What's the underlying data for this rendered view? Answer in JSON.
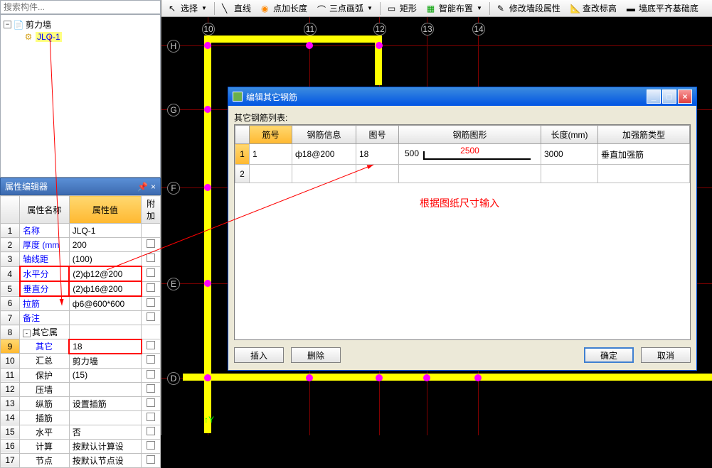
{
  "search_placeholder": "搜索构件...",
  "tree": {
    "root": "剪力墙",
    "child": "JLQ-1"
  },
  "prop_editor_title": "属性编辑器",
  "prop_headers": {
    "name": "属性名称",
    "value": "属性值",
    "extra": "附加"
  },
  "props": [
    {
      "n": "1",
      "name": "名称",
      "val": "JLQ-1",
      "blue": true
    },
    {
      "n": "2",
      "name": "厚度 (mm",
      "val": "200",
      "blue": true,
      "check": true
    },
    {
      "n": "3",
      "name": "轴线距",
      "val": "(100)",
      "blue": true,
      "check": true
    },
    {
      "n": "4",
      "name": "水平分",
      "val": "(2)ф12@200",
      "blue": true,
      "check": true,
      "hl": true
    },
    {
      "n": "5",
      "name": "垂直分",
      "val": "(2)ф16@200",
      "blue": true,
      "check": true,
      "hl": true
    },
    {
      "n": "6",
      "name": "拉筋",
      "val": "ф6@600*600",
      "blue": true,
      "check": true
    },
    {
      "n": "7",
      "name": "备注",
      "val": "",
      "blue": true,
      "check": true
    },
    {
      "n": "8",
      "name": "其它属",
      "val": "",
      "black": true,
      "expand": "-"
    },
    {
      "n": "9",
      "name": "其它",
      "val": "18",
      "blue": true,
      "check": true,
      "indent": 2,
      "selrow": true,
      "hlval": true
    },
    {
      "n": "10",
      "name": "汇总",
      "val": "剪力墙",
      "black": true,
      "check": true,
      "indent": 2
    },
    {
      "n": "11",
      "name": "保护",
      "val": "(15)",
      "black": true,
      "check": true,
      "indent": 2
    },
    {
      "n": "12",
      "name": "压墙",
      "val": "",
      "black": true,
      "check": true,
      "indent": 2
    },
    {
      "n": "13",
      "name": "纵筋",
      "val": "设置插筋",
      "black": true,
      "check": true,
      "indent": 2
    },
    {
      "n": "14",
      "name": "插筋",
      "val": "",
      "black": true,
      "check": true,
      "indent": 2
    },
    {
      "n": "15",
      "name": "水平",
      "val": "否",
      "black": true,
      "check": true,
      "indent": 2
    },
    {
      "n": "16",
      "name": "计算",
      "val": "按默认计算设",
      "black": true,
      "check": true,
      "indent": 2
    },
    {
      "n": "17",
      "name": "节点",
      "val": "按默认节点设",
      "black": true,
      "check": true,
      "indent": 2
    }
  ],
  "toolbar": {
    "select": "选择",
    "line": "直线",
    "point_len": "点加长度",
    "arc3": "三点画弧",
    "rect": "矩形",
    "smart": "智能布置",
    "modify_wall": "修改墙段属性",
    "check_elev": "查改标高",
    "wall_align": "墙底平齐基础底"
  },
  "axis": {
    "h": [
      "10",
      "11",
      "12",
      "13",
      "14"
    ],
    "v": [
      "H",
      "G",
      "F",
      "E",
      "D"
    ]
  },
  "dialog": {
    "title": "编辑其它钢筋",
    "list_label": "其它钢筋列表:",
    "headers": {
      "num": "筋号",
      "info": "钢筋信息",
      "fig": "图号",
      "shape": "钢筋图形",
      "len": "长度(mm)",
      "type": "加强筋类型"
    },
    "row1": {
      "num": "1",
      "info": "ф18@200",
      "fig": "18",
      "shape_l": "500",
      "shape_v": "2500",
      "len": "3000",
      "type": "垂直加强筋"
    },
    "annotation": "根据图纸尺寸输入",
    "btns": {
      "insert": "插入",
      "delete": "删除",
      "ok": "确定",
      "cancel": "取消"
    }
  },
  "coord": {
    "y": "Y"
  }
}
